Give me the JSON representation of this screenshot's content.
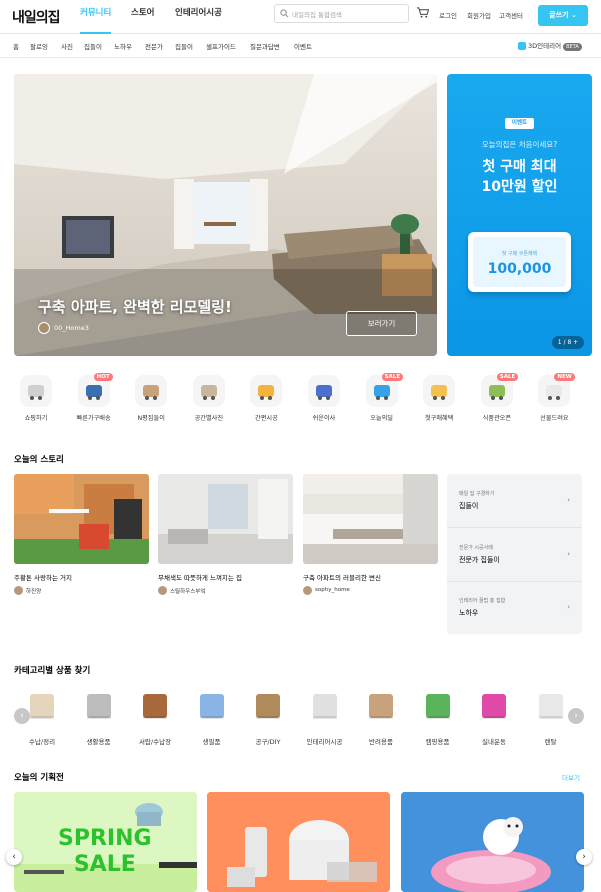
{
  "header": {
    "logo": "내일의집",
    "nav": [
      "커뮤니티",
      "스토어",
      "인테리어시공"
    ],
    "search_placeholder": "내일의집 통합검색",
    "links": [
      "로그인",
      "회원가입",
      "고객센터"
    ],
    "write_button": "글쓰기"
  },
  "subnav": {
    "items": [
      "홈",
      "팔로잉",
      "사진",
      "집들이",
      "노하우",
      "전문가",
      "집들이",
      "셀프가이드",
      "질문과답변",
      "이벤트"
    ],
    "three_d": "3D인테리어",
    "beta": "BETA"
  },
  "hero": {
    "title": "구축 아파트, 완벽한 리모델링!",
    "user": "00_Home3",
    "button": "보러가기"
  },
  "promo": {
    "tag": "이벤트",
    "question": "오늘의집은 처음이세요?",
    "line1": "첫 구매 최대",
    "line2": "10만원 할인",
    "coupon_label": "첫 구매 쿠폰혜택",
    "coupon_value": "100,000",
    "pager": "1 / 8 +"
  },
  "categories": [
    {
      "label": "쇼핑하기",
      "icon": "shopping-cart-icon",
      "badge": ""
    },
    {
      "label": "빠른가구배송",
      "icon": "delivery-truck-icon",
      "badge": "HOT"
    },
    {
      "label": "N평집들이",
      "icon": "house-icon",
      "badge": ""
    },
    {
      "label": "공간별사진",
      "icon": "armchair-icon",
      "badge": ""
    },
    {
      "label": "간편시공",
      "icon": "worker-icon",
      "badge": ""
    },
    {
      "label": "쉬운이사",
      "icon": "moving-cart-icon",
      "badge": ""
    },
    {
      "label": "오늘의딜",
      "icon": "alarm-clock-icon",
      "badge": "SALE"
    },
    {
      "label": "첫구매혜택",
      "icon": "coupon-icon",
      "badge": ""
    },
    {
      "label": "식품관오픈",
      "icon": "grocery-bag-icon",
      "badge": "SALE"
    },
    {
      "label": "선물드려요",
      "icon": "gift-dome-icon",
      "badge": "NEW"
    }
  ],
  "stories": {
    "title": "오늘의 스토리",
    "items": [
      {
        "title": "주황톤 사랑하는 거지",
        "user": "하진양"
      },
      {
        "title": "무채색도 따뜻하게 느껴지는 집",
        "user": "스틸하우스부엌"
      },
      {
        "title": "구축 아파트의 러블리한 변신",
        "user": "sophy_home"
      }
    ],
    "side": [
      {
        "sub": "매일 집 구경하기",
        "main": "집들이"
      },
      {
        "sub": "전문가 시공사례",
        "main": "전문가 집들이"
      },
      {
        "sub": "인테리어 꿀팁 총 집합",
        "main": "노하우"
      }
    ]
  },
  "product_categories": {
    "title": "카테고리별 상품 찾기",
    "items": [
      "수납/정리",
      "생활용품",
      "서랍/수납장",
      "생필품",
      "공구/DIY",
      "인테리어시공",
      "반려용품",
      "캠핑용품",
      "실내운동",
      "렌탈"
    ]
  },
  "exhibitions": {
    "title": "오늘의 기획전",
    "more": "더보기",
    "spring1": "SPRING",
    "spring2": "SALE"
  },
  "colors": {
    "accent": "#35c5f0",
    "promo": "#0d9be8"
  }
}
